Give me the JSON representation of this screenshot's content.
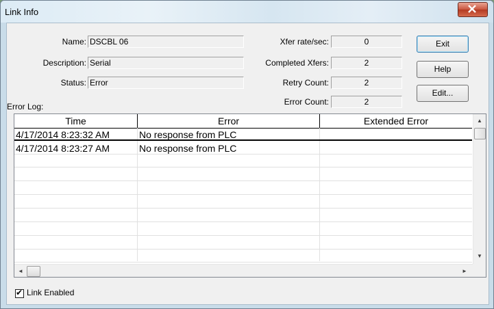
{
  "window": {
    "title": "Link Info",
    "close_label": "X"
  },
  "fields": {
    "name_label": "Name:",
    "name_value": "DSCBL 06",
    "description_label": "Description:",
    "description_value": "Serial",
    "status_label": "Status:",
    "status_value": "Error",
    "xfer_rate_label": "Xfer rate/sec:",
    "xfer_rate_value": "0",
    "completed_label": "Completed Xfers:",
    "completed_value": "2",
    "retry_label": "Retry Count:",
    "retry_value": "2",
    "error_count_label": "Error Count:",
    "error_count_value": "2"
  },
  "buttons": {
    "exit": "Exit",
    "help": "Help",
    "edit": "Edit..."
  },
  "error_log": {
    "label": "Error Log:",
    "columns": [
      "Time",
      "Error",
      "Extended Error"
    ],
    "rows": [
      [
        "4/17/2014 8:23:32 AM",
        "No response from PLC",
        ""
      ],
      [
        "4/17/2014 8:23:27 AM",
        "No response from PLC",
        ""
      ]
    ]
  },
  "link_enabled": {
    "label": "Link Enabled",
    "checked": true,
    "check_glyph": "✔"
  },
  "scroll_glyphs": {
    "up": "▲",
    "down": "▼",
    "left": "◄",
    "right": "►"
  },
  "icons": {
    "close": "close-icon",
    "check": "checkmark-icon"
  }
}
